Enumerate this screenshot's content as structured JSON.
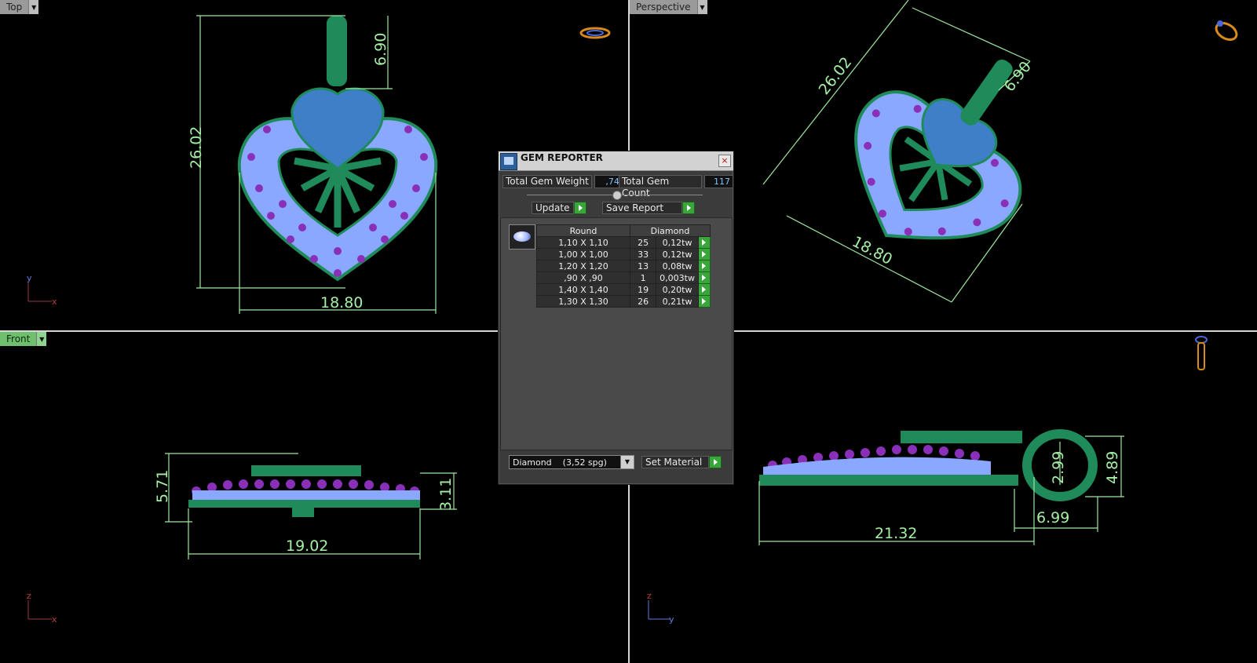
{
  "viewports": {
    "top": {
      "label": "Top",
      "dims": [
        "26.02",
        "6.90",
        "18.80"
      ],
      "axis": [
        "y",
        "x"
      ]
    },
    "perspective": {
      "label": "Perspective",
      "dims": [
        "26.02",
        "6.90",
        "18.80"
      ]
    },
    "front": {
      "label": "Front",
      "dims": [
        "5.71",
        "3.11",
        "19.02"
      ],
      "axis": [
        "z",
        "x"
      ]
    },
    "right": {
      "dims": [
        "21.32",
        "6.99",
        "2.99",
        "4.89"
      ],
      "axis": [
        "z",
        "y"
      ]
    }
  },
  "gem_reporter": {
    "title": "GEM REPORTER",
    "close_label": "×",
    "total_weight_label": "Total Gem Weight",
    "total_weight_value": ",74",
    "total_count_label": "Total Gem Count",
    "total_count_value": "117",
    "update_label": "Update",
    "save_report_label": "Save Report",
    "table": {
      "headers": [
        "Round",
        "Diamond"
      ],
      "rows": [
        {
          "size": "1,10 X 1,10",
          "count": "25",
          "weight": "0,12tw"
        },
        {
          "size": "1,00 X 1,00",
          "count": "33",
          "weight": "0,12tw"
        },
        {
          "size": "1,20 X 1,20",
          "count": "13",
          "weight": "0,08tw"
        },
        {
          "size": ",90 X ,90",
          "count": "1",
          "weight": "0,003tw"
        },
        {
          "size": "1,40 X 1,40",
          "count": "19",
          "weight": "0,20tw"
        },
        {
          "size": "1,30 X 1,30",
          "count": "26",
          "weight": "0,21tw"
        }
      ]
    },
    "material_value": "Diamond    (3,52 spg)",
    "set_material_label": "Set Material"
  },
  "colors": {
    "dimension_line": "#9ee89e",
    "metal": "#1f8a5a",
    "stone_blue": "#7f9cff",
    "stone_purple": "#8a2fb8"
  },
  "icons": [
    "ring-top-icon",
    "ring-perspective-icon",
    "pendant-side-icon",
    "dropdown-arrow-icon",
    "play-arrow-icon",
    "gem-thumbnail-icon",
    "close-icon"
  ]
}
